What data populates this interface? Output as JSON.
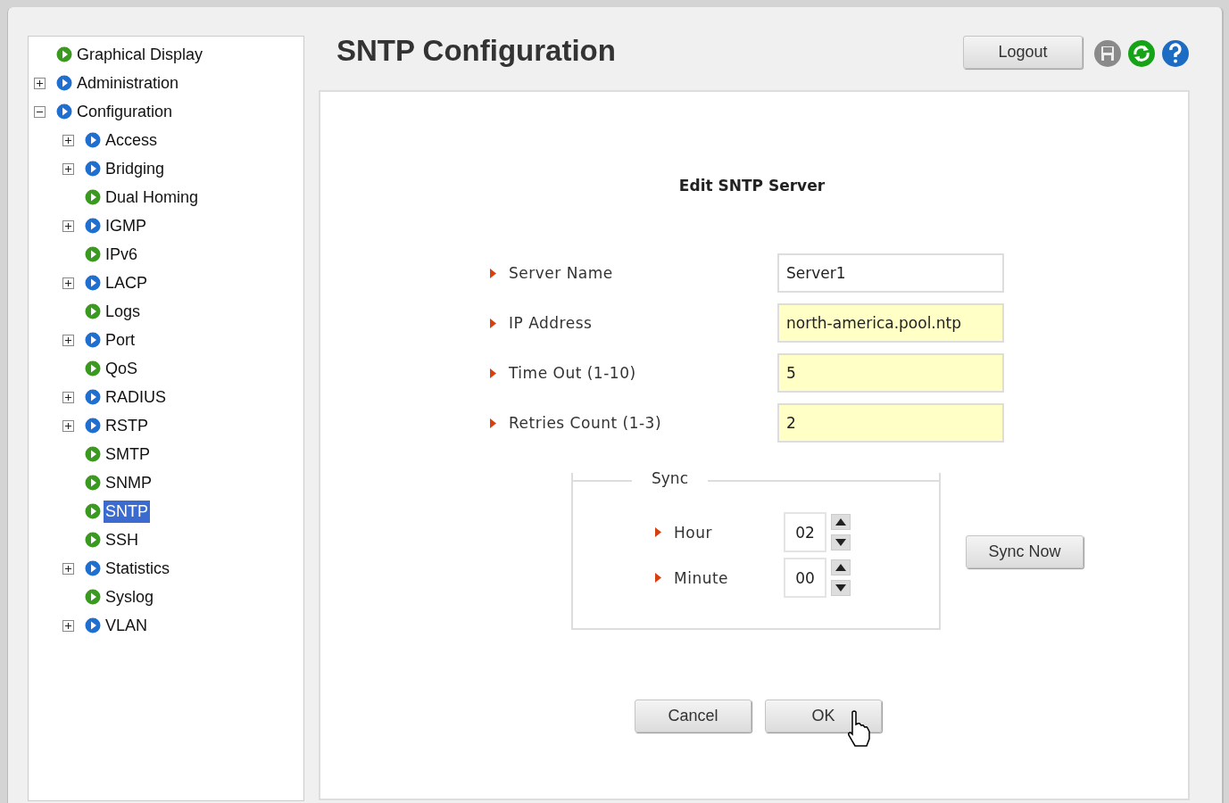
{
  "sidebar": {
    "items": [
      {
        "label": "Graphical Display",
        "kind": "leaf",
        "selected": false
      },
      {
        "label": "Administration",
        "kind": "folder",
        "expanded": false,
        "selected": false
      },
      {
        "label": "Configuration",
        "kind": "folder",
        "expanded": true,
        "selected": false,
        "children": [
          {
            "label": "Access",
            "kind": "folder",
            "expanded": false,
            "selected": false
          },
          {
            "label": "Bridging",
            "kind": "folder",
            "expanded": false,
            "selected": false
          },
          {
            "label": "Dual Homing",
            "kind": "leaf",
            "selected": false
          },
          {
            "label": "IGMP",
            "kind": "folder",
            "expanded": false,
            "selected": false
          },
          {
            "label": "IPv6",
            "kind": "leaf",
            "selected": false
          },
          {
            "label": "LACP",
            "kind": "folder",
            "expanded": false,
            "selected": false
          },
          {
            "label": "Logs",
            "kind": "leaf",
            "selected": false
          },
          {
            "label": "Port",
            "kind": "folder",
            "expanded": false,
            "selected": false
          },
          {
            "label": "QoS",
            "kind": "leaf",
            "selected": false
          },
          {
            "label": "RADIUS",
            "kind": "folder",
            "expanded": false,
            "selected": false
          },
          {
            "label": "RSTP",
            "kind": "folder",
            "expanded": false,
            "selected": false
          },
          {
            "label": "SMTP",
            "kind": "leaf",
            "selected": false
          },
          {
            "label": "SNMP",
            "kind": "leaf",
            "selected": false
          },
          {
            "label": "SNTP",
            "kind": "leaf",
            "selected": true
          },
          {
            "label": "SSH",
            "kind": "leaf",
            "selected": false
          },
          {
            "label": "Statistics",
            "kind": "folder",
            "expanded": false,
            "selected": false
          },
          {
            "label": "Syslog",
            "kind": "leaf",
            "selected": false
          },
          {
            "label": "VLAN",
            "kind": "folder",
            "expanded": false,
            "selected": false
          }
        ]
      }
    ]
  },
  "page_title": "SNTP Configuration",
  "logout_button": "Logout",
  "form": {
    "title": "Edit SNTP Server",
    "fields": [
      {
        "label": "Server Name",
        "value": "Server1",
        "highlighted": false
      },
      {
        "label": "IP Address",
        "value": "north-america.pool.ntp",
        "highlighted": true
      },
      {
        "label": "Time Out (1-10)",
        "value": "5",
        "highlighted": true
      },
      {
        "label": "Retries Count (1-3)",
        "value": "2",
        "highlighted": true
      }
    ],
    "sync": {
      "legend": "Sync",
      "fields": [
        {
          "label": "Hour",
          "value": "02"
        },
        {
          "label": "Minute",
          "value": "00"
        }
      ],
      "button": "Sync Now"
    },
    "buttons": [
      "Cancel",
      "OK"
    ]
  }
}
